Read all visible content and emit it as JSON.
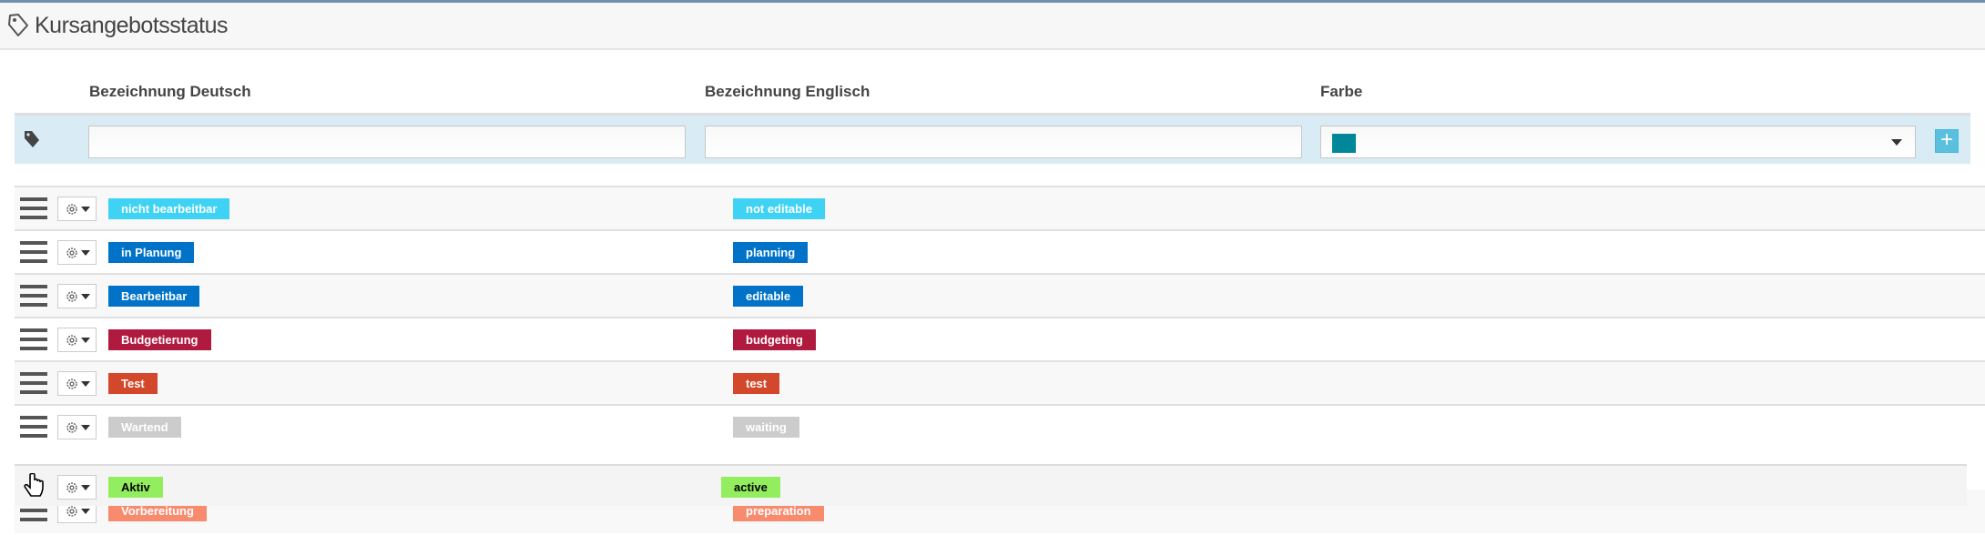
{
  "header": {
    "title": "Kursangebotsstatus",
    "icon": "tag-outline-icon"
  },
  "columns": {
    "german": "Bezeichnung Deutsch",
    "english": "Bezeichnung Englisch",
    "color": "Farbe"
  },
  "new_entry": {
    "german_value": "",
    "english_value": "",
    "color_value": "#00879a",
    "add_icon": "plus-icon"
  },
  "rows": [
    {
      "de": "nicht bearbeitbar",
      "en": "not editable",
      "color": "#3ed3f5",
      "text_color": "#ffffff"
    },
    {
      "de": "in Planung",
      "en": "planning",
      "color": "#0073c8",
      "text_color": "#ffffff"
    },
    {
      "de": "Bearbeitbar",
      "en": "editable",
      "color": "#0073c8",
      "text_color": "#ffffff"
    },
    {
      "de": "Budgetierung",
      "en": "budgeting",
      "color": "#b01a3f",
      "text_color": "#ffffff"
    },
    {
      "de": "Test",
      "en": "test",
      "color": "#d3482a",
      "text_color": "#ffffff"
    },
    {
      "de": "Wartend",
      "en": "waiting",
      "color": "#cccccc",
      "text_color": "#ffffff"
    },
    {
      "de": "Vorbereitung",
      "en": "preparation",
      "color": "#f88a6e",
      "text_color": "#ffffff"
    }
  ],
  "dragging_row": {
    "de": "Aktiv",
    "en": "active",
    "color": "#93ee5f",
    "text_color": "#000000"
  }
}
